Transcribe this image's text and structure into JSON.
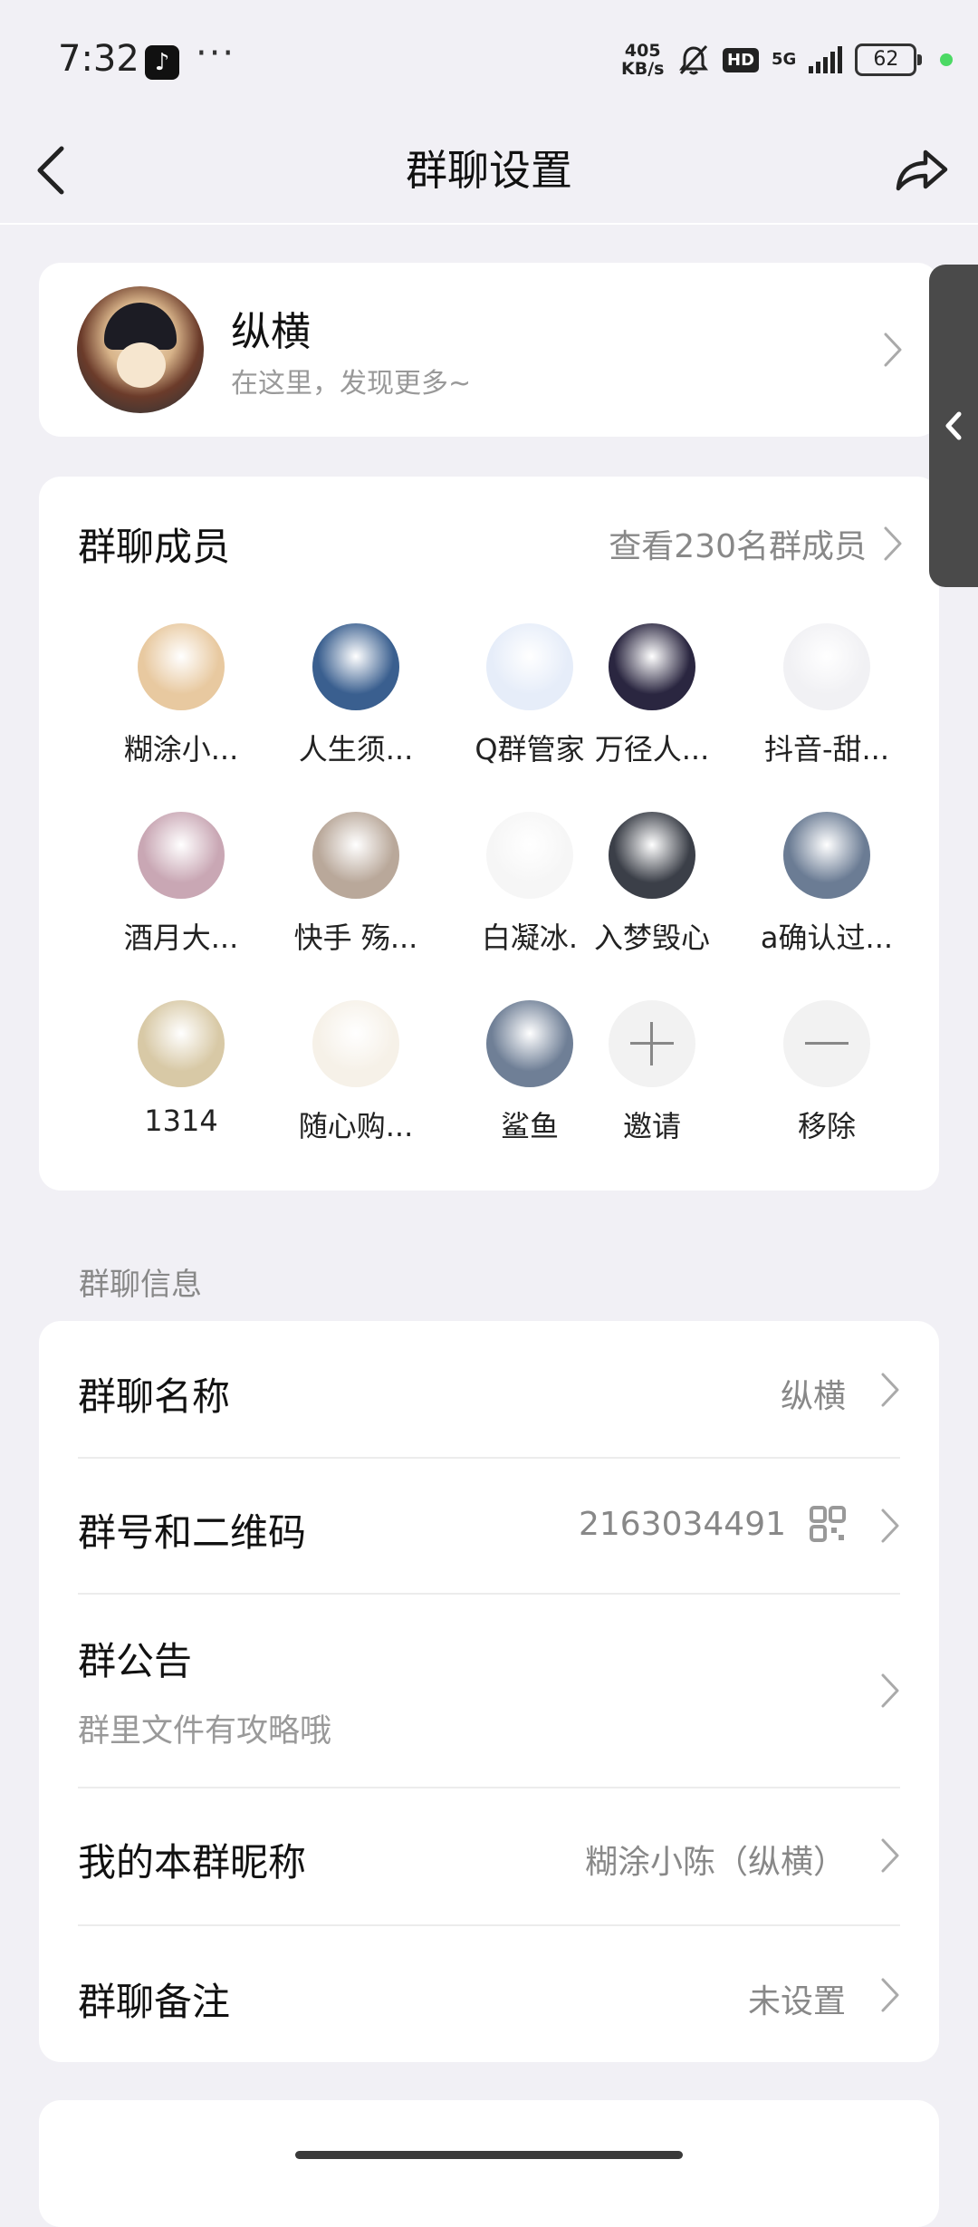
{
  "status_bar": {
    "time": "7:32",
    "dots": "···",
    "net_speed_value": "405",
    "net_speed_unit": "KB/s",
    "hd": "HD",
    "network": "5G",
    "battery": "62",
    "app_icon": "tiktok-icon"
  },
  "nav": {
    "title": "群聊设置",
    "back_icon": "chevron-left-icon",
    "share_icon": "share-icon"
  },
  "profile": {
    "name": "纵横",
    "subtitle": "在这里，发现更多~"
  },
  "members": {
    "title": "群聊成员",
    "view_all": "查看230名群成员",
    "list": [
      {
        "name": "糊涂小...",
        "color": "#e8c9a0"
      },
      {
        "name": "人生须...",
        "color": "#3a5f8f"
      },
      {
        "name": "Q群管家",
        "color": "#e6edf9"
      },
      {
        "name": "万径人...",
        "color": "#2a2640"
      },
      {
        "name": "抖音-甜...",
        "color": "#f1f1f4"
      },
      {
        "name": "酒月大...",
        "color": "#c9a7b4"
      },
      {
        "name": "快手  殇...",
        "color": "#b9a89a"
      },
      {
        "name": "白凝冰.",
        "color": "#f6f6f6"
      },
      {
        "name": "入梦毁心",
        "color": "#3b3f48"
      },
      {
        "name": "a确认过...",
        "color": "#6b7c94"
      },
      {
        "name": "1314",
        "color": "#d8c9a6"
      },
      {
        "name": "随心购...",
        "color": "#f6f1e8"
      },
      {
        "name": "鲨鱼",
        "color": "#6f7f96"
      }
    ],
    "invite": "邀请",
    "remove": "移除"
  },
  "section": {
    "info_label": "群聊信息"
  },
  "info": {
    "name_label": "群聊名称",
    "name_value": "纵横",
    "id_label": "群号和二维码",
    "id_value": "2163034491",
    "notice_label": "群公告",
    "notice_value": "群里文件有攻略哦",
    "nickname_label": "我的本群昵称",
    "nickname_value": "糊涂小陈（纵横）",
    "remark_label": "群聊备注",
    "remark_value": "未设置"
  }
}
